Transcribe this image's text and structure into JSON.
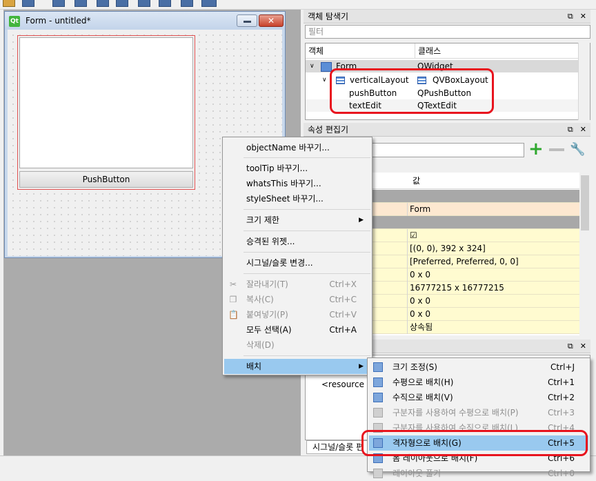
{
  "form_window": {
    "title": "Form - untitled*",
    "logo": "Qt",
    "close_glyph": "✕",
    "push_button_label": "PushButton"
  },
  "object_inspector": {
    "title": "객체 탐색기",
    "filter_placeholder": "필터",
    "col_object": "객체",
    "col_class": "클래스",
    "rows": [
      {
        "name": "Form",
        "class": "QWidget"
      },
      {
        "name": "verticalLayout",
        "class": "QVBoxLayout"
      },
      {
        "name": "pushButton",
        "class": "QPushButton"
      },
      {
        "name": "textEdit",
        "class": "QTextEdit"
      }
    ]
  },
  "property_editor": {
    "title": "속성 편집기",
    "col_value": "값",
    "rows": [
      {
        "key": "",
        "value": ""
      },
      {
        "key": "",
        "value": "Form"
      },
      {
        "key": "",
        "value": ""
      },
      {
        "key": "",
        "value": "☑"
      },
      {
        "key": "",
        "value": "[(0, 0), 392 x 324]"
      },
      {
        "key": "",
        "value": "[Preferred, Preferred, 0, 0]"
      },
      {
        "key": "",
        "value": "0 x 0"
      },
      {
        "key": "e",
        "value": "16777215 x 16777215"
      },
      {
        "key": "",
        "value": "0 x 0"
      },
      {
        "key": "",
        "value": "0 x 0"
      },
      {
        "key": "",
        "value": "상속됨"
      }
    ]
  },
  "resource_panel": {
    "text": "<resource ro",
    "tab_label": "시그널/슬롯 편"
  },
  "context_menu": {
    "items": [
      {
        "label": "objectName 바꾸기...",
        "shortcut": ""
      },
      {
        "label": "toolTip 바꾸기...",
        "shortcut": ""
      },
      {
        "label": "whatsThis 바꾸기...",
        "shortcut": ""
      },
      {
        "label": "styleSheet 바꾸기...",
        "shortcut": ""
      },
      {
        "label": "크기 제한",
        "shortcut": ""
      },
      {
        "label": "승격된 위젯...",
        "shortcut": ""
      },
      {
        "label": "시그널/슬롯 변경...",
        "shortcut": ""
      },
      {
        "label": "잘라내기(T)",
        "shortcut": "Ctrl+X"
      },
      {
        "label": "복사(C)",
        "shortcut": "Ctrl+C"
      },
      {
        "label": "붙여넣기(P)",
        "shortcut": "Ctrl+V"
      },
      {
        "label": "모두 선택(A)",
        "shortcut": "Ctrl+A"
      },
      {
        "label": "삭제(D)",
        "shortcut": ""
      },
      {
        "label": "배치",
        "shortcut": ""
      }
    ]
  },
  "layout_submenu": {
    "items": [
      {
        "label": "크기 조정(S)",
        "shortcut": "Ctrl+J"
      },
      {
        "label": "수평으로 배치(H)",
        "shortcut": "Ctrl+1"
      },
      {
        "label": "수직으로 배치(V)",
        "shortcut": "Ctrl+2"
      },
      {
        "label": "구분자를 사용하여 수평으로 배치(P)",
        "shortcut": "Ctrl+3"
      },
      {
        "label": "구분자를 사용하여 수직으로 배치(L)",
        "shortcut": "Ctrl+4"
      },
      {
        "label": "격자형으로 배치(G)",
        "shortcut": "Ctrl+5"
      },
      {
        "label": "폼 레이아웃으로 배치(F)",
        "shortcut": "Ctrl+6"
      },
      {
        "label": "레이아웃 풀기",
        "shortcut": "Ctrl+0"
      }
    ]
  },
  "colors": {
    "highlight": "#e8141e",
    "menu_selected": "#99c9ef",
    "property_row": "#fffbd0"
  }
}
